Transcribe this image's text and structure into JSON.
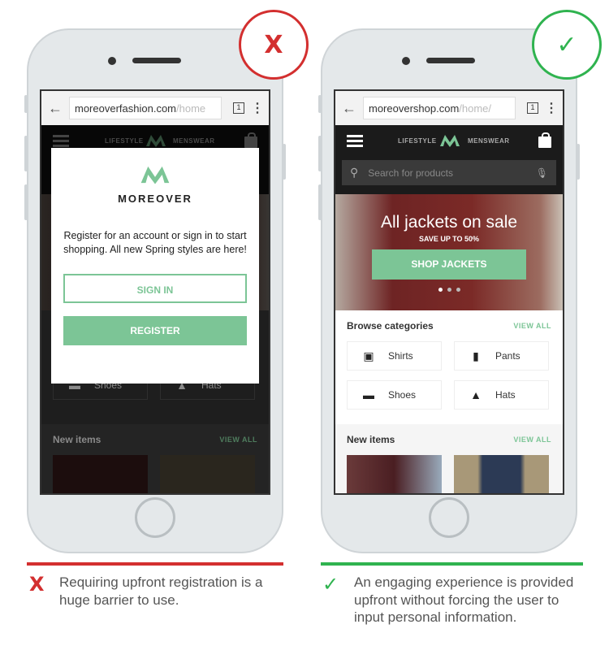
{
  "colors": {
    "bad": "#d32f2f",
    "good": "#2fb34f",
    "accent": "#7cc596"
  },
  "bad": {
    "verdict_icon": "x-icon",
    "verdict_symbol": "X",
    "browser": {
      "url_host": "moreoverfashion.com",
      "url_path": "/home",
      "tab_count": "1"
    },
    "nav": {
      "left": "LIFESTYLE",
      "right": "MENSWEAR"
    },
    "modal": {
      "brand": "MOREOVER",
      "message": "Register for an account or sign in to start shopping. All new Spring styles are here!",
      "sign_in": "SIGN IN",
      "register": "REGISTER"
    },
    "categories": {
      "items": [
        {
          "label": "Shoes"
        },
        {
          "label": "Hats"
        }
      ]
    },
    "new_items": {
      "title": "New items",
      "view_all": "VIEW ALL"
    },
    "caption_mark": "X",
    "caption": "Requiring upfront registration is a huge barrier to use."
  },
  "good": {
    "verdict_icon": "check-icon",
    "verdict_symbol": "✓",
    "browser": {
      "url_host": "moreovershop.com",
      "url_path": "/home/",
      "tab_count": "1"
    },
    "nav": {
      "left": "LIFESTYLE",
      "right": "MENSWEAR"
    },
    "search": {
      "placeholder": "Search for products"
    },
    "hero": {
      "title": "All jackets on sale",
      "subtitle": "SAVE UP TO 50%",
      "button": "SHOP JACKETS",
      "slide": 1,
      "slides": 3
    },
    "categories": {
      "title": "Browse categories",
      "view_all": "VIEW ALL",
      "items": [
        {
          "label": "Shirts",
          "icon": "shirt-icon"
        },
        {
          "label": "Pants",
          "icon": "pants-icon"
        },
        {
          "label": "Shoes",
          "icon": "shoe-icon"
        },
        {
          "label": "Hats",
          "icon": "hat-icon"
        }
      ]
    },
    "new_items": {
      "title": "New items",
      "view_all": "VIEW ALL"
    },
    "caption_mark": "✓",
    "caption": "An engaging experience is provided upfront without forcing the user to input personal information."
  }
}
